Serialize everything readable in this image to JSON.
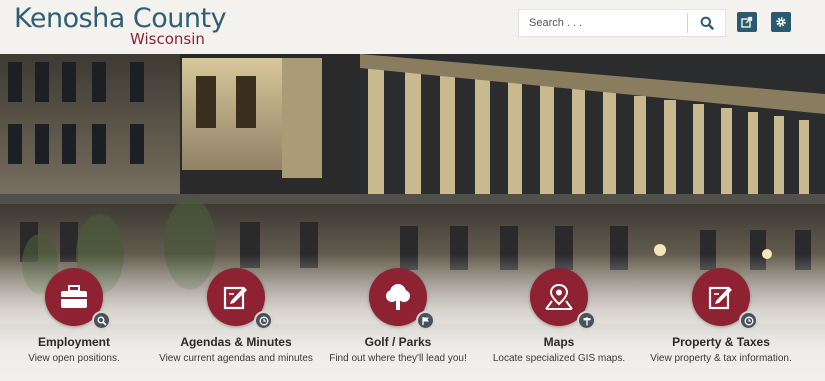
{
  "header": {
    "logo_title": "Kenosha County",
    "logo_subtitle": "Wisconsin",
    "search_placeholder": "Search . . .",
    "search_icon": "magnifier-icon",
    "share_icon": "share-icon",
    "settings_icon": "gear-icon"
  },
  "colors": {
    "brand_blue": "#2f5f73",
    "brand_maroon": "#8e2233",
    "badge_gray": "#48525c"
  },
  "quick_links": [
    {
      "title": "Employment",
      "description": "View open positions.",
      "icon": "briefcase-icon",
      "badge": "search-icon"
    },
    {
      "title": "Agendas & Minutes",
      "description": "View current agendas and minutes",
      "icon": "document-edit-icon",
      "badge": "clock-icon"
    },
    {
      "title": "Golf / Parks",
      "description": "Find out where they'll lead you!",
      "icon": "tree-icon",
      "badge": "flag-icon"
    },
    {
      "title": "Maps",
      "description": "Locate specialized GIS maps.",
      "icon": "map-pin-icon",
      "badge": "signpost-icon"
    },
    {
      "title": "Property & Taxes",
      "description": "View property & tax information.",
      "icon": "document-edit-icon",
      "badge": "clock-icon"
    }
  ]
}
